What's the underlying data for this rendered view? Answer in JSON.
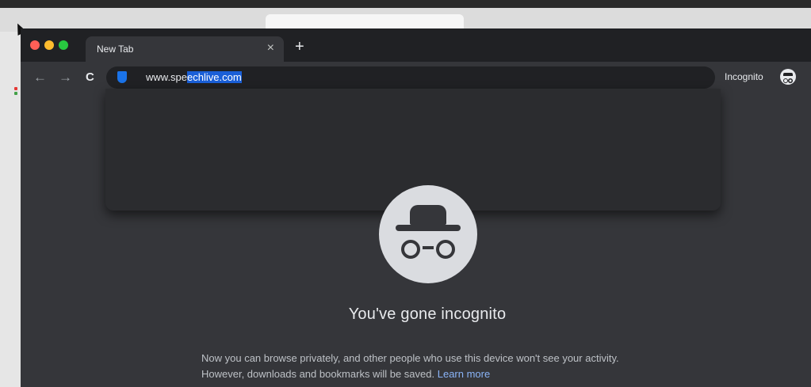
{
  "browser": {
    "tab_title": "New Tab",
    "tab_close": "×",
    "new_tab": "+"
  },
  "toolbar": {
    "back": "←",
    "forward": "→",
    "reload": "C",
    "url_prefix": "www.spe",
    "url_selected": "echlive.com",
    "profile_label": "Incognito"
  },
  "incognito": {
    "headline": "You've gone incognito",
    "description": "Now you can browse privately, and other people who use this device won't see your activity. However, downloads and bookmarks will be saved.",
    "learn_more": "Learn more"
  },
  "colors": {
    "frame": "#202124",
    "content": "#35363a",
    "accent": "#8ab4f8",
    "selection": "#1a5fd7"
  },
  "icons": [
    "shield-icon",
    "incognito-icon",
    "back-arrow-icon",
    "forward-arrow-icon",
    "reload-icon",
    "close-icon",
    "plus-icon"
  ]
}
